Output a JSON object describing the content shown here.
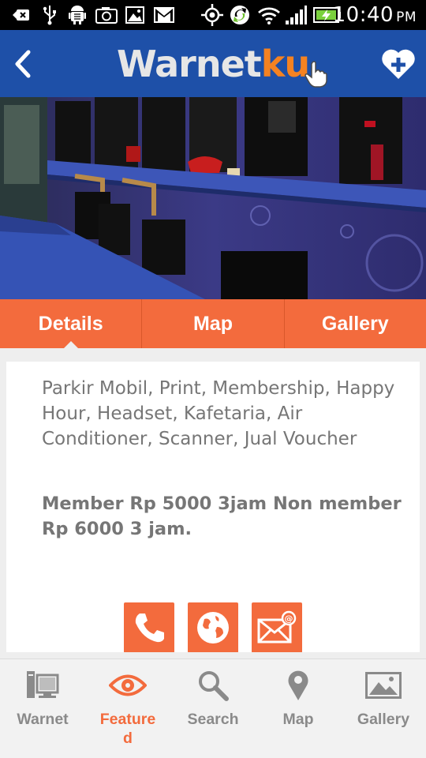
{
  "status_bar": {
    "time": "10:40",
    "ampm": "PM",
    "icons": [
      "back-notification-icon",
      "usb-icon",
      "android-debug-icon",
      "camera-icon",
      "gallery-icon",
      "gmail-icon",
      "gps-icon",
      "sync-icon",
      "wifi-icon",
      "signal-icon",
      "battery-charging-icon"
    ]
  },
  "header": {
    "logo_part1": "Warnet",
    "logo_part2": "ku",
    "back_icon": "back-arrow-icon",
    "favorite_icon": "heart-plus-icon",
    "colors": {
      "bar": "#1e50a8",
      "logo_grey": "#e6e6e6",
      "logo_orange": "#f58221"
    }
  },
  "tabs": [
    {
      "label": "Details",
      "active": true
    },
    {
      "label": "Map",
      "active": false
    },
    {
      "label": "Gallery",
      "active": false
    }
  ],
  "details": {
    "facilities": "Parkir Mobil, Print, Membership, Happy Hour, Headset, Kafetaria, Air Conditioner, Scanner, Jual Voucher",
    "price": "Member Rp 5000 3jam Non member Rp 6000 3 jam."
  },
  "actions": [
    {
      "icon": "phone-icon"
    },
    {
      "icon": "globe-icon"
    },
    {
      "icon": "email-icon"
    }
  ],
  "bottom_nav": [
    {
      "label": "Warnet",
      "icon": "computer-icon",
      "active": false
    },
    {
      "label": "Feature\nd",
      "icon": "eye-icon",
      "active": true
    },
    {
      "label": "Search",
      "icon": "magnifier-icon",
      "active": false
    },
    {
      "label": "Map",
      "icon": "map-pin-icon",
      "active": false
    },
    {
      "label": "Gallery",
      "icon": "picture-icon",
      "active": false
    }
  ],
  "accent_color": "#f36b3d"
}
